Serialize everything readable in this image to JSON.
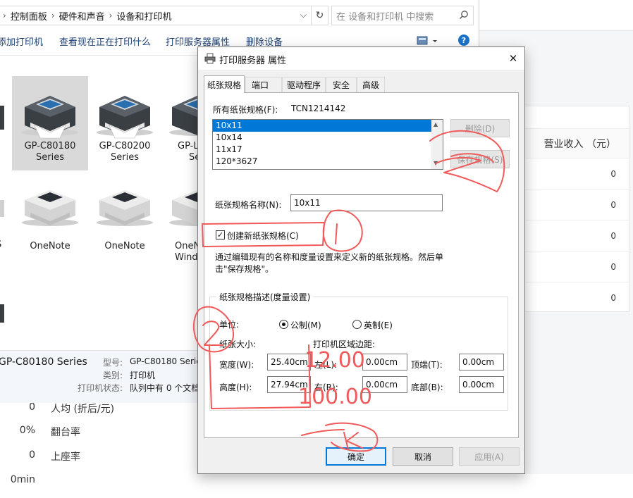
{
  "explorer": {
    "breadcrumb": [
      "控制面板",
      "硬件和声音",
      "设备和打印机"
    ],
    "search_placeholder": "在 设备和打印机 中搜索",
    "commands": [
      "添加打印机",
      "查看现在正在打印什么",
      "打印服务器属性",
      "删除设备"
    ],
    "help_label": "?",
    "devices": [
      {
        "name_line1": "GP-C80180",
        "name_line2": "Series",
        "selected": true
      },
      {
        "name_line1": "GP-C80200",
        "name_line2": "Series",
        "selected": false
      },
      {
        "name_line1": "GP-L",
        "name_line2": "Se",
        "selected": false
      },
      {
        "name_line1": "OneNote",
        "name_line2": "",
        "selected": false
      },
      {
        "name_line1": "OneNote",
        "name_line2": "",
        "selected": false
      },
      {
        "name_line1": "OneN",
        "name_line2": "Windo",
        "selected": false
      }
    ],
    "left_edge_label": "S",
    "details": {
      "name": "GP-C80180 Series",
      "model_label": "型号:",
      "model_value": "GP-C80180 Serie",
      "category_label": "类别:",
      "category_value": "打印机",
      "status_label": "打印机状态:",
      "status_value": "队列中有 0 个文档"
    }
  },
  "background": {
    "card_header": "营业收入 （元）",
    "card_values": [
      "0",
      "0",
      "0",
      "0",
      "0"
    ],
    "stats": [
      {
        "value": "0",
        "label": "人均 (折后/元)"
      },
      {
        "value": "0%",
        "label": "翻台率"
      },
      {
        "value": "0",
        "label": "上座率"
      },
      {
        "value": "0min",
        "label": ""
      }
    ]
  },
  "dialog": {
    "title": "打印服务器 属性",
    "close_label": "✕",
    "tabs": [
      "纸张规格",
      "端口",
      "驱动程序",
      "安全",
      "高级"
    ],
    "all_forms_label": "所有纸张规格(F):",
    "server_name": "TCN1214142",
    "forms": [
      "10x11",
      "10x14",
      "11x17",
      "120*3627"
    ],
    "delete_button": "删除(D)",
    "save_button": "保存规格(S)",
    "form_name_label": "纸张规格名称(N):",
    "form_name_value": "10x11",
    "create_new_label": "创建新纸张规格(C)",
    "create_new_checked": true,
    "help_text": "通过编辑现有的名称和度量设置来定义新的纸张规格。然后单击\"保存规格\"。",
    "group_title": "纸张规格描述(度量设置)",
    "units_label": "单位:",
    "metric_label": "公制(M)",
    "english_label": "英制(E)",
    "paper_size_label": "纸张大小:",
    "printer_margins_label": "打印机区域边距:",
    "width_label": "宽度(W):",
    "width_value": "25.40cm",
    "height_label": "高度(H):",
    "height_value": "27.94cm",
    "left_label": "左(L):",
    "left_value": "0.00cm",
    "right_label": "右(R):",
    "right_value": "0.00cm",
    "top_label": "顶端(T):",
    "top_value": "0.00cm",
    "bottom_label": "底部(B):",
    "bottom_value": "0.00cm",
    "ok_button": "确定",
    "cancel_button": "取消",
    "apply_button": "应用(A)"
  },
  "annotations": {
    "width_override": "12.00",
    "height_override": "100.00",
    "color": "#f05a5a"
  }
}
